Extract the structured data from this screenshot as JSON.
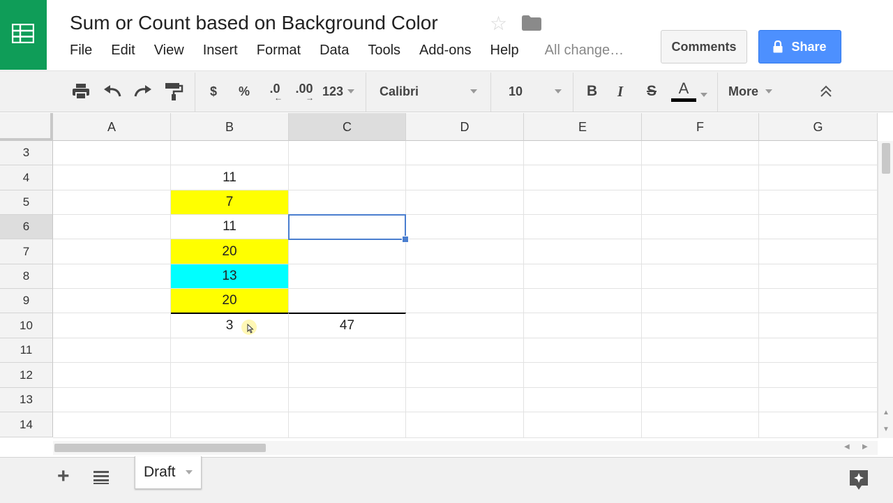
{
  "app": {
    "doc_title": "Sum or Count based on Background Color",
    "menu": [
      "File",
      "Edit",
      "View",
      "Insert",
      "Format",
      "Data",
      "Tools",
      "Add-ons",
      "Help"
    ],
    "save_status": "All change…",
    "comments_label": "Comments",
    "share_label": "Share",
    "brand_color": "#0f9d58",
    "share_color": "#4d90fe"
  },
  "toolbar": {
    "currency": "$",
    "percent": "%",
    "decrease_decimals": ".0",
    "increase_decimals": ".00",
    "more_formats": "123",
    "font": "Calibri",
    "font_size": "10",
    "bold": "B",
    "italic": "I",
    "strikethrough": "S",
    "text_color": "A",
    "more": "More"
  },
  "grid": {
    "columns": [
      "A",
      "B",
      "C",
      "D",
      "E",
      "F",
      "G"
    ],
    "selected_column": "C",
    "rows": [
      "3",
      "4",
      "5",
      "6",
      "7",
      "8",
      "9",
      "10",
      "11",
      "12",
      "13",
      "14"
    ],
    "selected_row": "6",
    "active_cell": "C6",
    "cells": {
      "B4": "11",
      "B5": "7",
      "B6": "11",
      "B7": "20",
      "B8": "13",
      "B9": "20",
      "B10": "3",
      "C10": "47"
    },
    "cell_backgrounds": {
      "B5": "#ffff00",
      "B7": "#ffff00",
      "B8": "#00ffff",
      "B9": "#ffff00"
    }
  },
  "sheets": {
    "active": "Draft"
  }
}
